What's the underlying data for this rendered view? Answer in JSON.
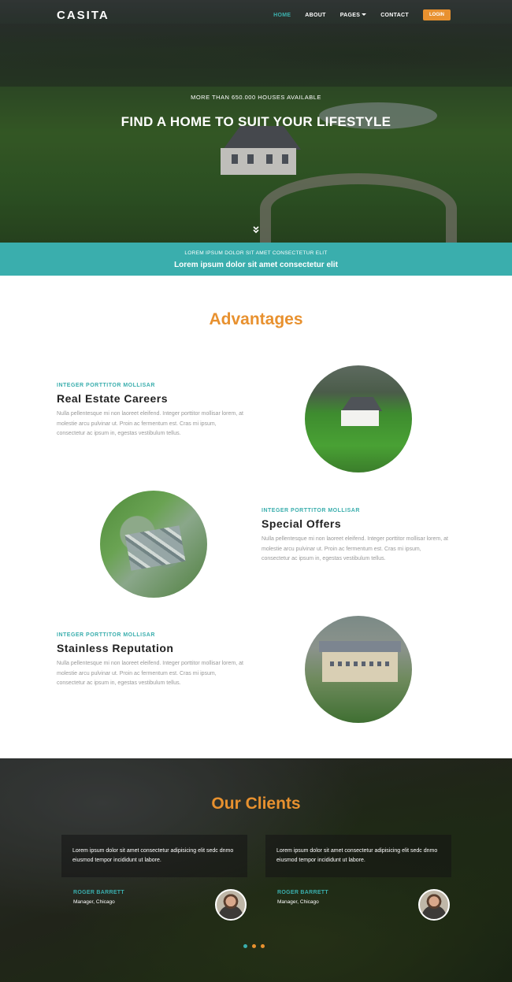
{
  "brand": {
    "logo": "CASITA"
  },
  "nav": {
    "items": [
      {
        "label": "HOME",
        "active": true
      },
      {
        "label": "ABOUT",
        "active": false
      },
      {
        "label": "PAGES",
        "active": false,
        "has_dropdown": true
      },
      {
        "label": "CONTACT",
        "active": false
      }
    ],
    "login_label": "LOGIN"
  },
  "hero": {
    "subtitle": "MORE THAN 650.000 HOUSES AVAILABLE",
    "title": "FIND A HOME TO SUIT YOUR LIFESTYLE",
    "scroll_icon": "chevron-double-down-icon"
  },
  "banner": {
    "small": "LOREM IPSUM DOLOR SIT AMET CONSECTETUR ELIT",
    "large": "Lorem ipsum dolor sit amet consectetur elit"
  },
  "advantages": {
    "title": "Advantages",
    "features": [
      {
        "kicker": "INTEGER PORTTITOR MOLLISAR",
        "heading": "Real Estate Careers",
        "text": "Nulla pellentesque mi non laoreet eleifend. Integer porttitor mollisar lorem, at molestie arcu pulvinar ut. Proin ac fermentum est. Cras mi ipsum, consectetur ac ipsum in, egestas vestibulum tellus."
      },
      {
        "kicker": "INTEGER PORTTITOR MOLLISAR",
        "heading": "Special Offers",
        "text": "Nulla pellentesque mi non laoreet eleifend. Integer porttitor mollisar lorem, at molestie arcu pulvinar ut. Proin ac fermentum est. Cras mi ipsum, consectetur ac ipsum in, egestas vestibulum tellus."
      },
      {
        "kicker": "INTEGER PORTTITOR MOLLISAR",
        "heading": "Stainless Reputation",
        "text": "Nulla pellentesque mi non laoreet eleifend. Integer porttitor mollisar lorem, at molestie arcu pulvinar ut. Proin ac fermentum est. Cras mi ipsum, consectetur ac ipsum in, egestas vestibulum tellus."
      }
    ]
  },
  "clients": {
    "title": "Our Clients",
    "testimonials": [
      {
        "quote": "Lorem ipsum dolor sit amet consectetur adipisicing elit sedc dnmo eiusmod tempor incididunt ut labore.",
        "name": "ROGER BARRETT",
        "role": "Manager, Chicago"
      },
      {
        "quote": "Lorem ipsum dolor sit amet consectetur adipisicing elit sedc dnmo eiusmod tempor incididunt ut labore.",
        "name": "ROGER BARRETT",
        "role": "Manager, Chicago"
      }
    ],
    "pager_active_index": 0
  },
  "colors": {
    "accent_orange": "#e8912f",
    "accent_teal": "#3aaead"
  }
}
